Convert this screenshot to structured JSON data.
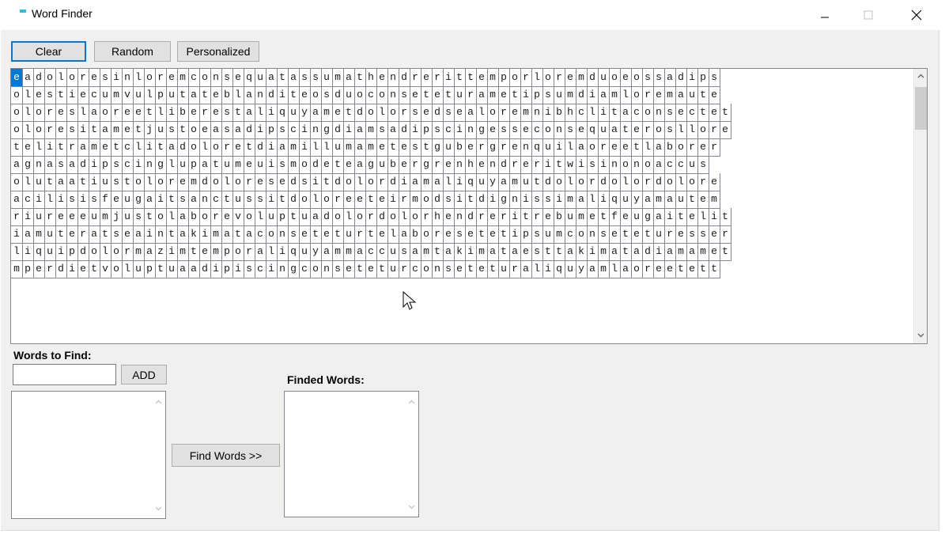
{
  "window": {
    "title": "Word Finder",
    "icon": "app-icon",
    "controls": [
      "minimize-icon",
      "maximize-icon",
      "close-icon"
    ]
  },
  "toolbar": {
    "clear_label": "Clear",
    "random_label": "Random",
    "personalized_label": "Personalized"
  },
  "grid": {
    "rows": [
      "eadoloresinloremconsequatassumathendreritt emporloremduoeossadips",
      "olestiecumvulputateblanditeosduoconseteturametipsumdiamloremaute",
      "oloreslaoreetliberestaliquyametdolorsedsealoremnibhclitaconsectet",
      "oloresitametjustoeasadipscingdiamsadipscingesseconsequaterosllore",
      "telitrametclitadoloretdiamillumametestgubergrenquilaoreetlaborer",
      "agnasadipscinglupatumeuismodeteagubergrenhendreritwisinonoaccus",
      "olutaatiustoloremdoloresedsitdolordiamaliquyamutdolordolordolore",
      "acilisisfeugaitsanctussitdoloreeteirmodsitdignissimaliquyamautem",
      "riureeeumjustolaborevoluptuadolordolorhendreritrebumetfeugaitelit",
      "iamuteratseaintakimataconseteturtelaboresetetipsumconseteturesser",
      "liquipdolormazimtemporaliquyammaccusamtakimataesttakimatadiamamet",
      "mperdietvoluptuaadipiscingconseteturconseteturaliquyamlaoreetett"
    ],
    "selected": "0,0"
  },
  "words_section": {
    "label": "Words to Find:",
    "input_value": "",
    "add_label": "ADD"
  },
  "finder": {
    "find_label": "Find Words >>",
    "found_label": "Finded Words:"
  }
}
